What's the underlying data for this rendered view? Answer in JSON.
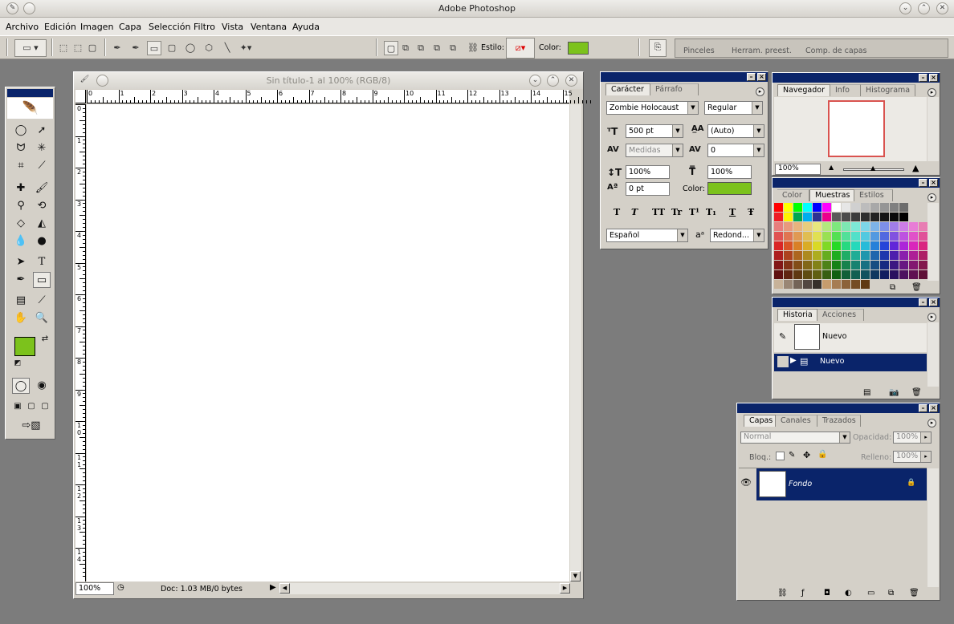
{
  "window": {
    "title": "Adobe Photoshop"
  },
  "menu": [
    "Archivo",
    "Edición",
    "Imagen",
    "Capa",
    "Selección",
    "Filtro",
    "Vista",
    "Ventana",
    "Ayuda"
  ],
  "options": {
    "style_label": "Estilo:",
    "color_label": "Color:",
    "color": "#7cc21c",
    "well_tabs": [
      "Pinceles",
      "Herram. preest.",
      "Comp. de capas"
    ]
  },
  "document": {
    "title": "Sin título-1 al 100% (RGB/8)",
    "zoom": "100%",
    "doc_info": "Doc: 1.03 MB/0 bytes",
    "hruler": [
      "0",
      "1",
      "2",
      "3",
      "4",
      "5",
      "6",
      "7",
      "8",
      "9",
      "10",
      "11",
      "12",
      "13",
      "14",
      "15"
    ],
    "vruler": [
      "0",
      "1",
      "2",
      "3",
      "4",
      "5",
      "6",
      "7",
      "8",
      "9",
      "10",
      "11",
      "12",
      "13",
      "14"
    ]
  },
  "character": {
    "tabs": [
      "Carácter",
      "Párrafo"
    ],
    "font": "Zombie Holocaust",
    "style": "Regular",
    "size": "500 pt",
    "leading": "(Auto)",
    "kerning": "Medidas",
    "tracking": "0",
    "vscale": "100%",
    "hscale": "100%",
    "baseline": "0 pt",
    "color_label": "Color:",
    "color": "#7cc21c",
    "styles": [
      "T",
      "T",
      "TT",
      "Tr",
      "T¹",
      "T₁",
      "T",
      "Ŧ"
    ],
    "language": "Español",
    "aa_label": "aᵃ",
    "antialias": "Redond..."
  },
  "navigator": {
    "tabs": [
      "Navegador",
      "Info",
      "Histograma"
    ],
    "zoom": "100%"
  },
  "swatches": {
    "tabs": [
      "Color",
      "Muestras",
      "Estilos"
    ]
  },
  "history": {
    "tabs": [
      "Historia",
      "Acciones"
    ],
    "snapshot": "Nuevo",
    "state": "Nuevo"
  },
  "layers": {
    "tabs": [
      "Capas",
      "Canales",
      "Trazados"
    ],
    "blend": "Normal",
    "opacity_label": "Opacidad:",
    "opacity": "100%",
    "lock_label": "Bloq.:",
    "fill_label": "Relleno:",
    "fill": "100%",
    "layer_name": "Fondo"
  },
  "toolbox": {
    "fg_color": "#7cc21c",
    "bg_color": "#000000"
  }
}
